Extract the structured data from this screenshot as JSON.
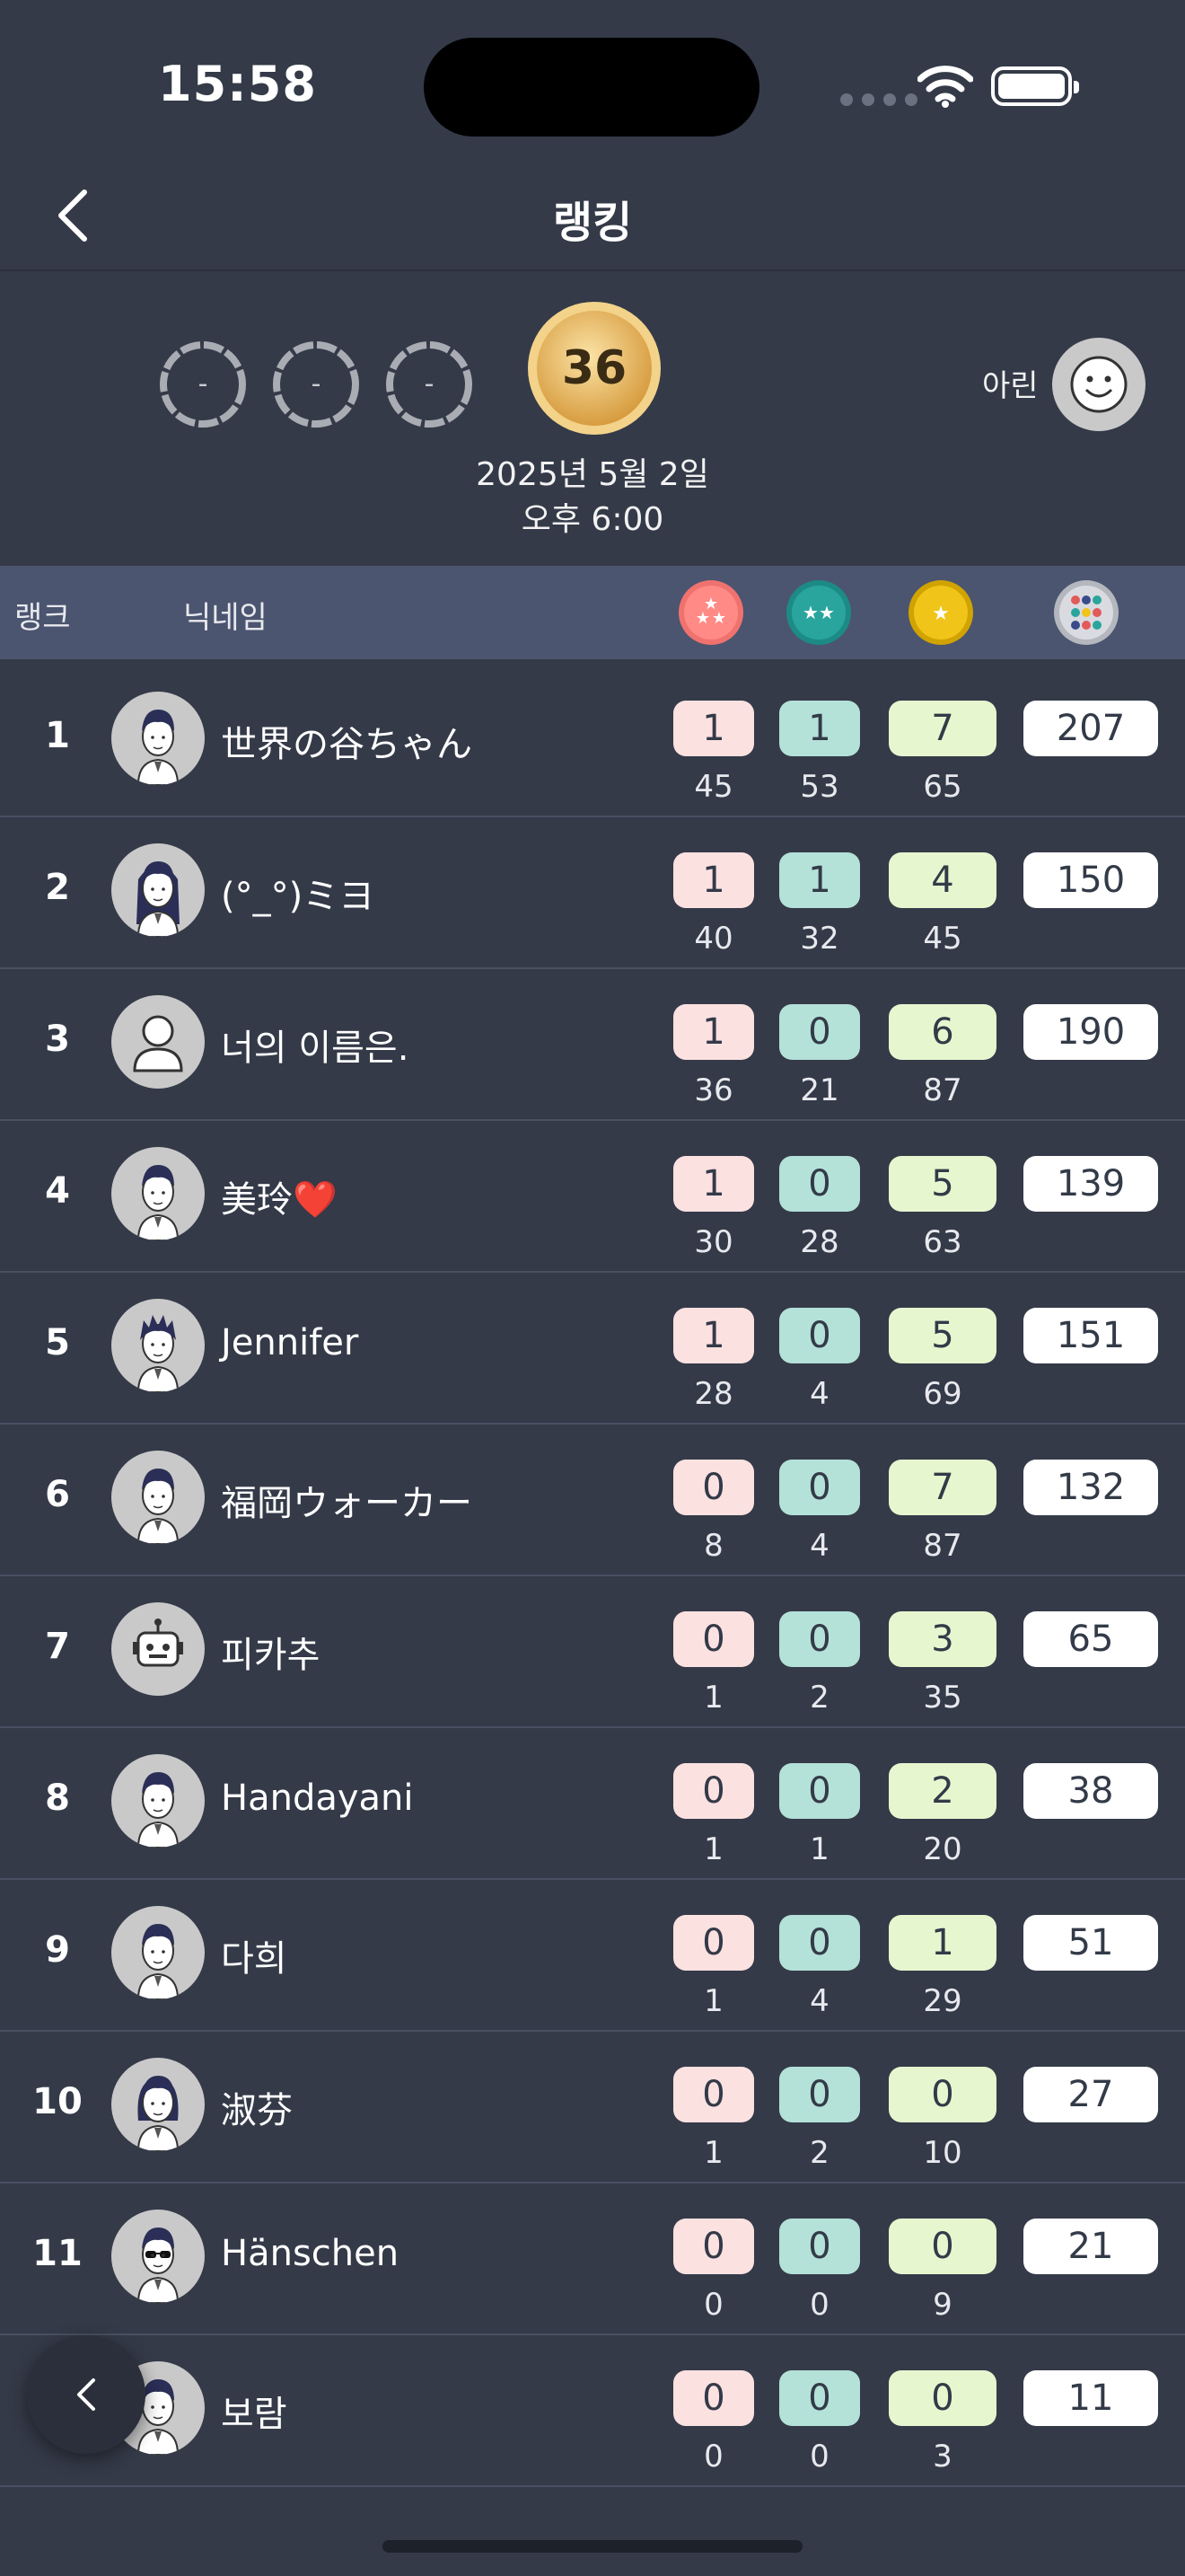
{
  "status_bar": {
    "time": "15:58"
  },
  "nav": {
    "title": "랭킹"
  },
  "summary": {
    "empty_medals": [
      "-",
      "-",
      "-"
    ],
    "score": "36",
    "date_line1": "2025년 5월 2일",
    "date_line2": "오후 6:00",
    "user_name": "아린"
  },
  "table_header": {
    "rank_label": "랭크",
    "nickname_label": "닉네임",
    "icons": [
      "three-star-icon",
      "two-star-icon",
      "one-star-icon",
      "dots-grid-icon"
    ]
  },
  "colors": {
    "background": "#343a48",
    "header_bg": "#4b5570",
    "pill_red": "#fce1e1",
    "pill_teal": "#b4e1d8",
    "pill_yellow": "#e6f7cf",
    "gold": "#e3ad4f"
  },
  "rows": [
    {
      "rank": "1",
      "nickname": "世界の谷ちゃん",
      "c3": "1",
      "c2": "1",
      "c1": "7",
      "total": "207",
      "s3": "45",
      "s2": "53",
      "s1": "65"
    },
    {
      "rank": "2",
      "nickname": "(°_°)ミヨ",
      "c3": "1",
      "c2": "1",
      "c1": "4",
      "total": "150",
      "s3": "40",
      "s2": "32",
      "s1": "45"
    },
    {
      "rank": "3",
      "nickname": "너의 이름은.",
      "c3": "1",
      "c2": "0",
      "c1": "6",
      "total": "190",
      "s3": "36",
      "s2": "21",
      "s1": "87"
    },
    {
      "rank": "4",
      "nickname": "美玲❤️",
      "c3": "1",
      "c2": "0",
      "c1": "5",
      "total": "139",
      "s3": "30",
      "s2": "28",
      "s1": "63"
    },
    {
      "rank": "5",
      "nickname": "Jennifer",
      "c3": "1",
      "c2": "0",
      "c1": "5",
      "total": "151",
      "s3": "28",
      "s2": "4",
      "s1": "69"
    },
    {
      "rank": "6",
      "nickname": "福岡ウォーカー",
      "c3": "0",
      "c2": "0",
      "c1": "7",
      "total": "132",
      "s3": "8",
      "s2": "4",
      "s1": "87"
    },
    {
      "rank": "7",
      "nickname": "피카추",
      "c3": "0",
      "c2": "0",
      "c1": "3",
      "total": "65",
      "s3": "1",
      "s2": "2",
      "s1": "35"
    },
    {
      "rank": "8",
      "nickname": "Handayani",
      "c3": "0",
      "c2": "0",
      "c1": "2",
      "total": "38",
      "s3": "1",
      "s2": "1",
      "s1": "20"
    },
    {
      "rank": "9",
      "nickname": "다희",
      "c3": "0",
      "c2": "0",
      "c1": "1",
      "total": "51",
      "s3": "1",
      "s2": "4",
      "s1": "29"
    },
    {
      "rank": "10",
      "nickname": "淑芬",
      "c3": "0",
      "c2": "0",
      "c1": "0",
      "total": "27",
      "s3": "1",
      "s2": "2",
      "s1": "10"
    },
    {
      "rank": "11",
      "nickname": "Hänschen",
      "c3": "0",
      "c2": "0",
      "c1": "0",
      "total": "21",
      "s3": "0",
      "s2": "0",
      "s1": "9"
    },
    {
      "rank": "",
      "nickname": "보람",
      "c3": "0",
      "c2": "0",
      "c1": "0",
      "total": "11",
      "s3": "0",
      "s2": "0",
      "s1": "3"
    }
  ],
  "avatars": [
    "man-avatar-icon",
    "woman-long-hair-avatar-icon",
    "default-person-avatar-icon",
    "man-avatar-icon",
    "spiky-hair-avatar-icon",
    "man-avatar-icon",
    "robot-avatar-icon",
    "man-avatar-icon",
    "man-avatar-icon",
    "woman-avatar-icon",
    "sunglasses-avatar-icon",
    "man-avatar-icon"
  ]
}
